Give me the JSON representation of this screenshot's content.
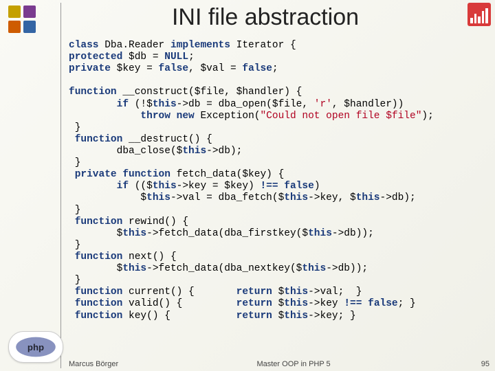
{
  "title": "INI file abstraction",
  "c": {
    "l0a": "class",
    "l0b": " Dba.Reader ",
    "l0c": "implements",
    "l0d": " Iterator {",
    "l1a": "protected",
    "l1b": " $db = ",
    "l1c": "NULL",
    "l1d": ";",
    "l2a": "private",
    "l2b": " $key = ",
    "l2c": "false",
    "l2d": ", $val = ",
    "l2e": "false",
    "l2f": ";",
    "l4a": "function",
    "l4b": " __construct($file, $handler) {",
    "l5a": "        ",
    "l5b": "if",
    "l5c": " (!$",
    "l5d": "this",
    "l5e": "->db = dba_open($file, ",
    "l5f": "'r'",
    "l5g": ", $handler))",
    "l6a": "            ",
    "l6b": "throw new",
    "l6c": " Exception(",
    "l6d": "\"Could not open file $file\"",
    "l6e": ");",
    "l8a": " }",
    "l9a": " function",
    "l9b": " __destruct() {",
    "l10a": "        dba_close($",
    "l10b": "this",
    "l10c": "->db);",
    "l11": " }",
    "l12a": " private function",
    "l12b": " fetch_data($key) {",
    "l13a": "        ",
    "l13b": "if",
    "l13c": " (($",
    "l13d": "this",
    "l13e": "->key = $key) ",
    "l13f": "!==",
    "l13g": " ",
    "l13h": "false",
    "l13i": ")",
    "l14a": "            $",
    "l14b": "this",
    "l14c": "->val = dba_fetch($",
    "l14d": "this",
    "l14e": "->key, $",
    "l14f": "this",
    "l14g": "->db);",
    "l15": " }",
    "l16a": " function",
    "l16b": " rewind() {",
    "l17a": "        $",
    "l17b": "this",
    "l17c": "->fetch_data(dba_firstkey($",
    "l17d": "this",
    "l17e": "->db));",
    "l18": " }",
    "l19a": " function",
    "l19b": " next() {",
    "l20a": "        $",
    "l20b": "this",
    "l20c": "->fetch_data(dba_nextkey($",
    "l20d": "this",
    "l20e": "->db));",
    "l21": " }",
    "l22a": " function",
    "l22b": " current() {       ",
    "l22c": "return",
    "l22d": " $",
    "l22e": "this",
    "l22f": "->val;  }",
    "l23a": " function",
    "l23b": " valid() {         ",
    "l23c": "return",
    "l23d": " $",
    "l23e": "this",
    "l23f": "->key ",
    "l23g": "!== false",
    "l23h": "; }",
    "l24a": " function",
    "l24b": " key() {           ",
    "l24c": "return",
    "l24d": " $",
    "l24e": "this",
    "l24f": "->key; }"
  },
  "footer": {
    "left": "Marcus Börger",
    "center": "Master OOP in PHP 5",
    "right": "95"
  }
}
